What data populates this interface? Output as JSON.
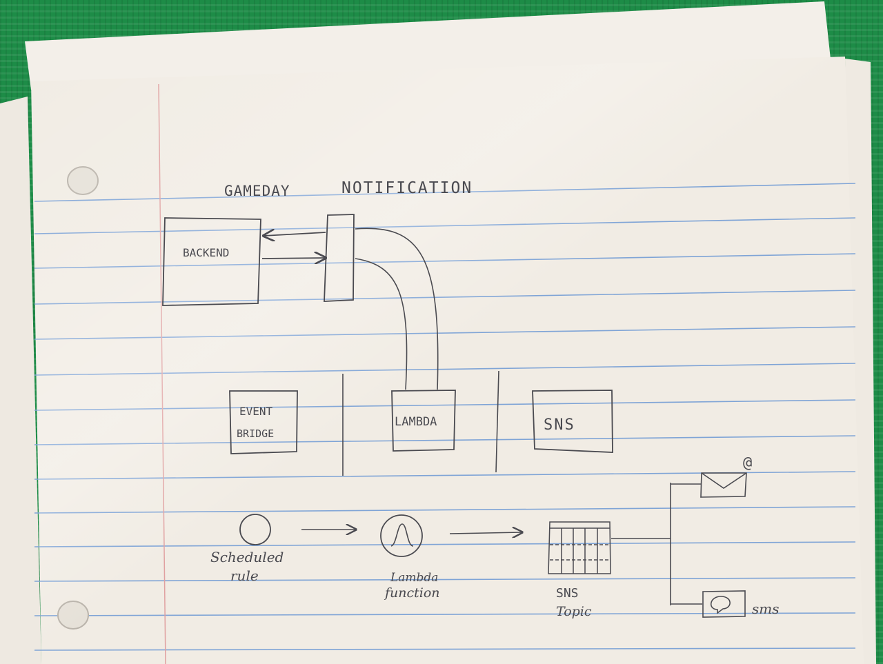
{
  "title": {
    "word1": "GAMEDAY",
    "word2": "NOTIFICATION"
  },
  "boxes": {
    "backend": "BACKEND",
    "event_bridge_line1": "EVENT",
    "event_bridge_line2": "BRIDGE",
    "lambda": "LAMBDA",
    "sns": "SNS"
  },
  "flow": {
    "scheduled_line1": "Scheduled",
    "scheduled_line2": "rule",
    "lambda_line1": "Lambda",
    "lambda_line2": "function",
    "topic_line1": "SNS",
    "topic_line2": "Topic",
    "email_symbol": "@",
    "sms": "sms"
  },
  "colors": {
    "ink": "#4a4a50",
    "rule_blue": "#7fa4d6",
    "margin_red": "#e0a0a0",
    "paper": "#f1ece4",
    "cloth": "#1d8c47"
  }
}
